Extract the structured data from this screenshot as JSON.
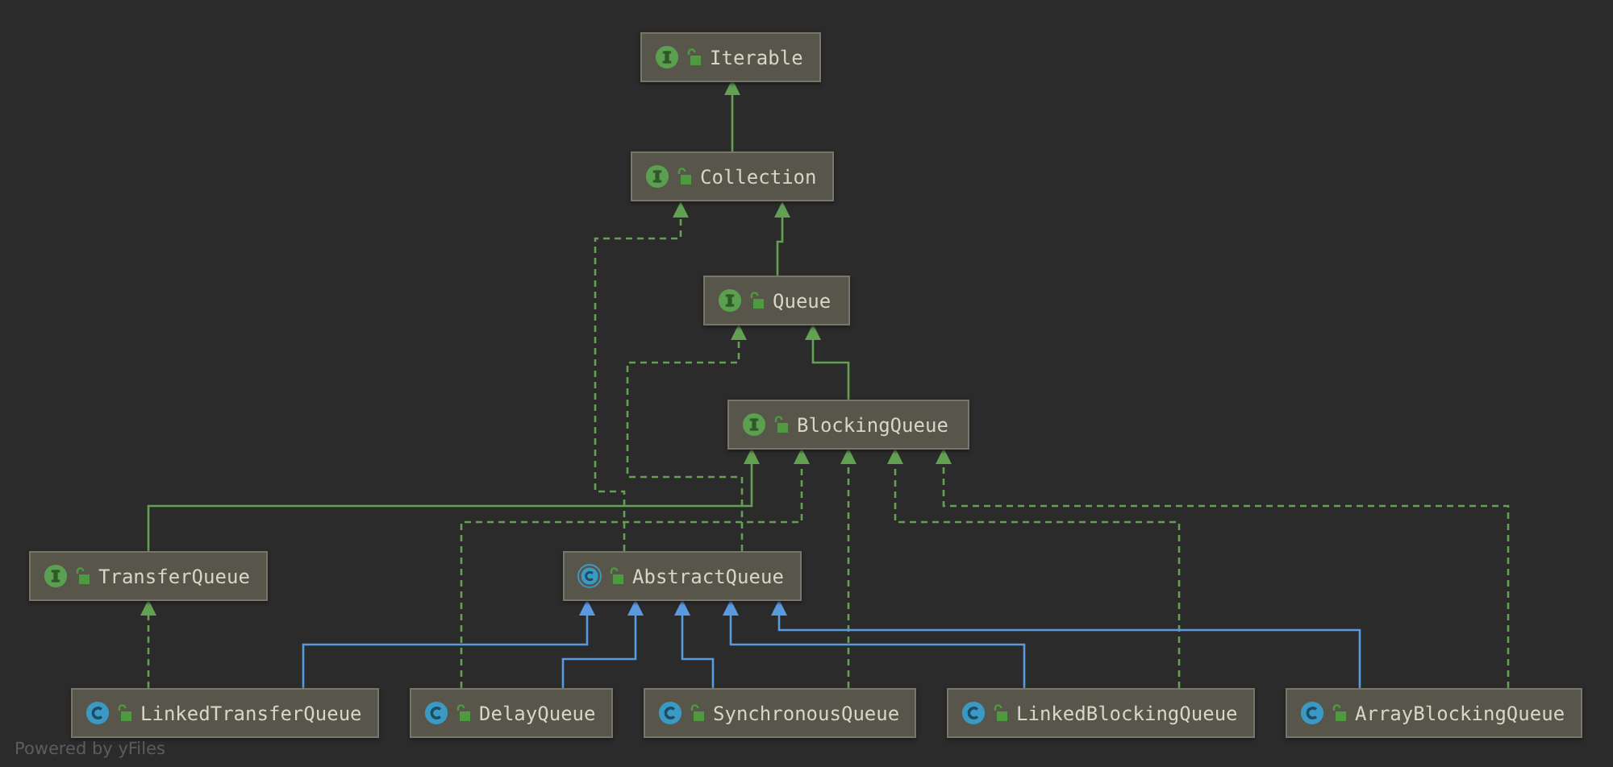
{
  "diagram": {
    "nodes": [
      {
        "label": "Iterable",
        "kind": "interface"
      },
      {
        "label": "Collection",
        "kind": "interface"
      },
      {
        "label": "Queue",
        "kind": "interface"
      },
      {
        "label": "BlockingQueue",
        "kind": "interface"
      },
      {
        "label": "TransferQueue",
        "kind": "interface"
      },
      {
        "label": "AbstractQueue",
        "kind": "abstract_class"
      },
      {
        "label": "LinkedTransferQueue",
        "kind": "class"
      },
      {
        "label": "DelayQueue",
        "kind": "class"
      },
      {
        "label": "SynchronousQueue",
        "kind": "class"
      },
      {
        "label": "LinkedBlockingQueue",
        "kind": "class"
      },
      {
        "label": "ArrayBlockingQueue",
        "kind": "class"
      }
    ],
    "edges": [
      {
        "kind": "extends_interface"
      },
      {
        "kind": "extends_interface"
      },
      {
        "kind": "extends_interface"
      },
      {
        "kind": "implements"
      },
      {
        "kind": "implements"
      },
      {
        "kind": "extends_interface"
      },
      {
        "kind": "implements"
      },
      {
        "kind": "implements"
      },
      {
        "kind": "implements"
      },
      {
        "kind": "implements"
      },
      {
        "kind": "implements"
      },
      {
        "kind": "extends"
      },
      {
        "kind": "extends"
      },
      {
        "kind": "extends"
      },
      {
        "kind": "extends"
      },
      {
        "kind": "extends"
      }
    ]
  },
  "footer": "Powered by yFiles"
}
